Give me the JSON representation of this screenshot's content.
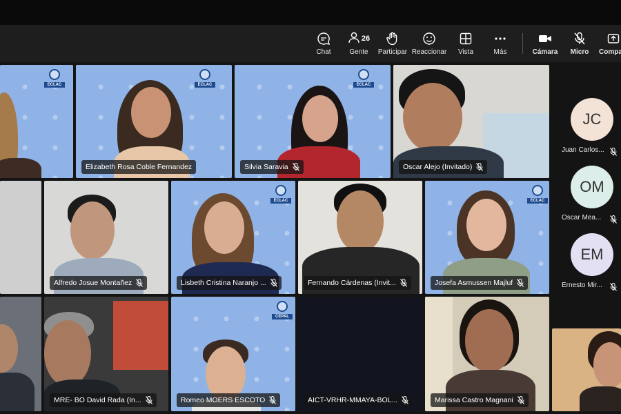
{
  "toolbar": {
    "chat": "Chat",
    "people": "Gente",
    "people_count": "26",
    "raise": "Participar",
    "react": "Reaccionar",
    "view": "Vista",
    "more": "Más",
    "camera": "Cámara",
    "mic": "Micro",
    "share": "Compa"
  },
  "tiles": {
    "t0": {
      "name": ""
    },
    "t1": {
      "name": "Elizabeth Rosa Coble Fernandez"
    },
    "t2": {
      "name": "Silvia Saravia"
    },
    "t3": {
      "name": "Oscar Alejo (Invitado)"
    },
    "t4": {
      "name": ""
    },
    "t5": {
      "name": "Alfredo Josue Montañez"
    },
    "t6": {
      "name": "Lisbeth Cristina Naranjo ..."
    },
    "t7": {
      "name": "Fernando Cárdenas (Invit..."
    },
    "t8": {
      "name": "Josefa Asmussen Majluf"
    },
    "t9": {
      "name": ""
    },
    "t10": {
      "name": "MRE- BO David Rada (In..."
    },
    "t11": {
      "name": "Romeo MOERS ESCOTO"
    },
    "t12": {
      "name": "AICT-VRHR-MMAYA-BOL..."
    },
    "t13": {
      "name": "Marissa Castro Magnani"
    }
  },
  "logos": {
    "eclac": "ECLAC",
    "cepal": "CEPAL"
  },
  "sidebar": [
    {
      "initials": "JC",
      "name": "Juan Carlos...",
      "color": "#f3e2d6"
    },
    {
      "initials": "OM",
      "name": "Oscar Mea...",
      "color": "#dceee9"
    },
    {
      "initials": "EM",
      "name": "Ernesto Mir...",
      "color": "#e4e0f3"
    }
  ]
}
